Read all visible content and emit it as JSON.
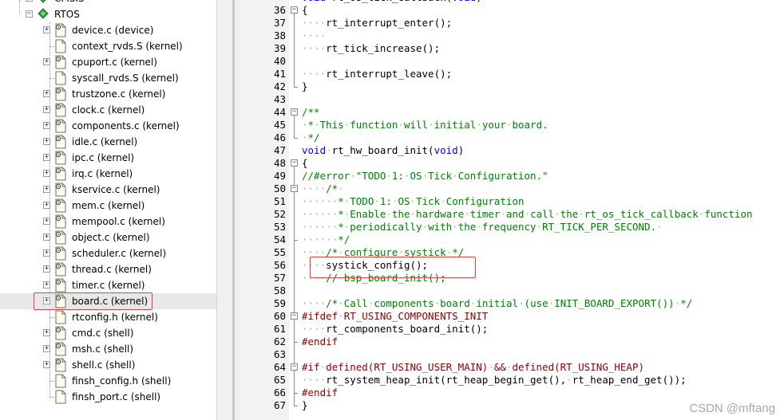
{
  "tree": {
    "items": [
      {
        "label": "CMSIS"
      },
      {
        "label": "RTOS"
      },
      {
        "label": "device.c (device)"
      },
      {
        "label": "context_rvds.S (kernel)"
      },
      {
        "label": "cpuport.c (kernel)"
      },
      {
        "label": "syscall_rvds.S (kernel)"
      },
      {
        "label": "trustzone.c (kernel)"
      },
      {
        "label": "clock.c (kernel)"
      },
      {
        "label": "components.c (kernel)"
      },
      {
        "label": "idle.c (kernel)"
      },
      {
        "label": "ipc.c (kernel)"
      },
      {
        "label": "irq.c (kernel)"
      },
      {
        "label": "kservice.c (kernel)"
      },
      {
        "label": "mem.c (kernel)"
      },
      {
        "label": "mempool.c (kernel)"
      },
      {
        "label": "object.c (kernel)"
      },
      {
        "label": "scheduler.c (kernel)"
      },
      {
        "label": "thread.c (kernel)"
      },
      {
        "label": "timer.c (kernel)"
      },
      {
        "label": "board.c (kernel)"
      },
      {
        "label": "rtconfig.h (kernel)"
      },
      {
        "label": "cmd.c (shell)"
      },
      {
        "label": "msh.c (shell)"
      },
      {
        "label": "shell.c (shell)"
      },
      {
        "label": "finsh_config.h (shell)"
      },
      {
        "label": "finsh_port.c (shell)"
      }
    ]
  },
  "editor": {
    "line_numbers": [
      "36",
      "37",
      "38",
      "39",
      "40",
      "41",
      "42",
      "43",
      "44",
      "45",
      "46",
      "47",
      "48",
      "49",
      "50",
      "51",
      "52",
      "53",
      "54",
      "55",
      "56",
      "57",
      "58",
      "59",
      "60",
      "61",
      "62",
      "63",
      "64",
      "65",
      "66",
      "67"
    ],
    "top_partial": "void rt_os_tick_callback(void)",
    "lines": [
      "{",
      "····rt_interrupt_enter();",
      "····",
      "····rt_tick_increase();",
      "",
      "····rt_interrupt_leave();",
      "}",
      "",
      "/**",
      "·*·This·function·will·initial·your·board.",
      "·*/",
      "void·rt_hw_board_init(void)",
      "{",
      "//#error·\"TODO·1:·OS·Tick·Configuration.\"",
      "····/*·",
      "······*·TODO·1:·OS·Tick·Configuration",
      "······*·Enable·the·hardware·timer·and·call·the·rt_os_tick_callback·function",
      "······*·periodically·with·the·frequency·RT_TICK_PER_SECOND.·",
      "······*/",
      "····/*·configure·systick·*/",
      "····systick_config();",
      "····//·bsp_board_init();",
      "",
      "····/*·Call·components·board·initial·(use·INIT_BOARD_EXPORT())·*/",
      "#ifdef·RT_USING_COMPONENTS_INIT",
      "····rt_components_board_init();",
      "#endif",
      "",
      "#if·defined(RT_USING_USER_MAIN)·&&·defined(RT_USING_HEAP)",
      "····rt_system_heap_init(rt_heap_begin_get(),·rt_heap_end_get());",
      "#endif",
      "}"
    ]
  },
  "watermark": "CSDN @mftang",
  "colors": {
    "keyword": "#0000ff",
    "comment": "#008000",
    "preprocessor": "#8b0000",
    "highlight": "#e0413c"
  }
}
